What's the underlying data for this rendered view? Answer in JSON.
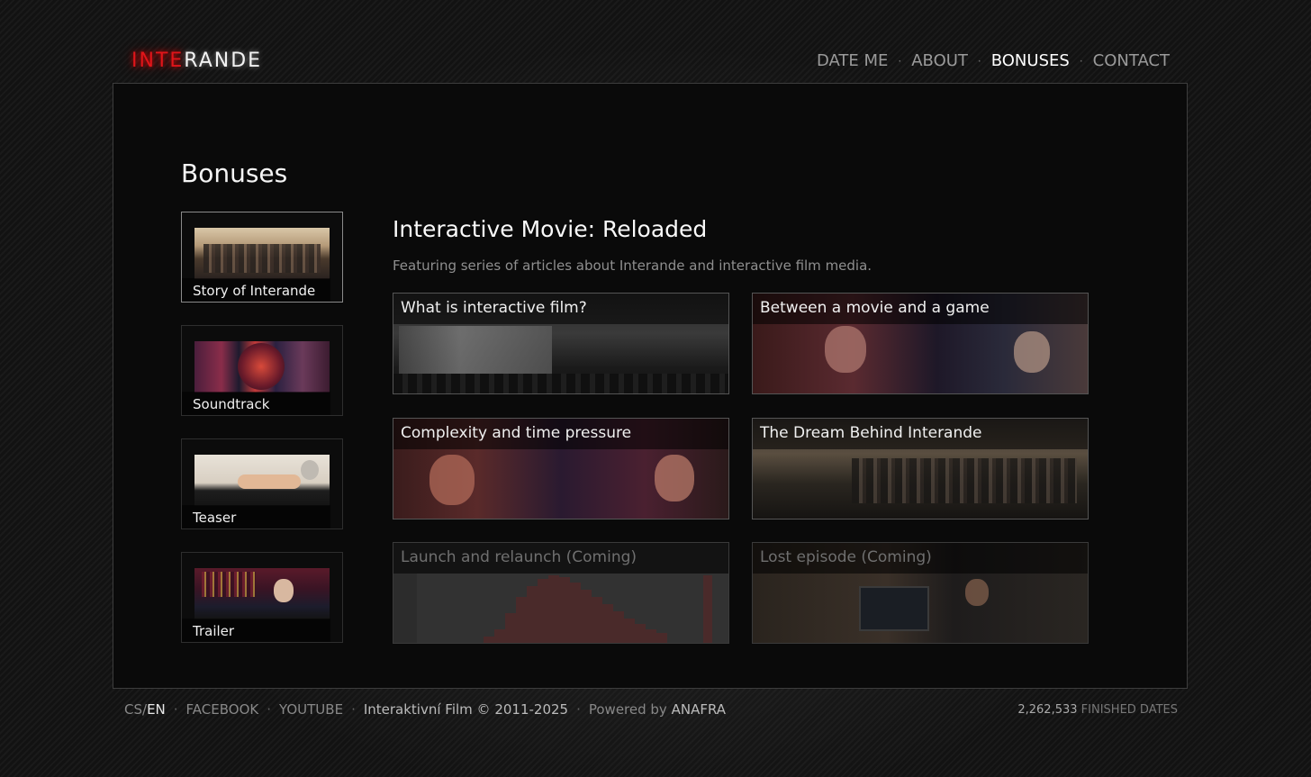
{
  "header": {
    "logo_part1": "INTE",
    "logo_part2": "RANDE",
    "nav": [
      {
        "label": "DATE ME",
        "active": false
      },
      {
        "label": "ABOUT",
        "active": false
      },
      {
        "label": "BONUSES",
        "active": true
      },
      {
        "label": "CONTACT",
        "active": false
      }
    ],
    "separator": "·"
  },
  "page": {
    "title": "Bonuses"
  },
  "sidebar": {
    "items": [
      {
        "label": "Story of Interande",
        "active": true,
        "thumb": "group-photo"
      },
      {
        "label": "Soundtrack",
        "active": false,
        "thumb": "album-covers"
      },
      {
        "label": "Teaser",
        "active": false,
        "thumb": "teaser-still"
      },
      {
        "label": "Trailer",
        "active": false,
        "thumb": "trailer-still"
      }
    ]
  },
  "article": {
    "heading": "Interactive Movie: Reloaded",
    "subtitle": "Featuring series of articles about Interande and interactive film media.",
    "cards": [
      {
        "title": "What is interactive film?",
        "coming": false
      },
      {
        "title": "Between a movie and a game",
        "coming": false
      },
      {
        "title": "Complexity and time pressure",
        "coming": false
      },
      {
        "title": "The Dream Behind Interande",
        "coming": false
      },
      {
        "title": "Launch and relaunch (Coming)",
        "coming": true
      },
      {
        "title": "Lost episode (Coming)",
        "coming": true
      }
    ]
  },
  "footer": {
    "lang_cs": "CS",
    "lang_slash": "/",
    "lang_en": "EN",
    "facebook": "FACEBOOK",
    "youtube": "YOUTUBE",
    "copyright": "Interaktivní Film © 2011-2025",
    "powered_by": "Powered by",
    "powered_name": "ANAFRA",
    "dot": "·",
    "counter_value": "2,262,533",
    "counter_label": "FINISHED DATES"
  },
  "colors": {
    "logo_red": "#e0151a",
    "background": "#121212",
    "panel": "#0a0a0a"
  }
}
